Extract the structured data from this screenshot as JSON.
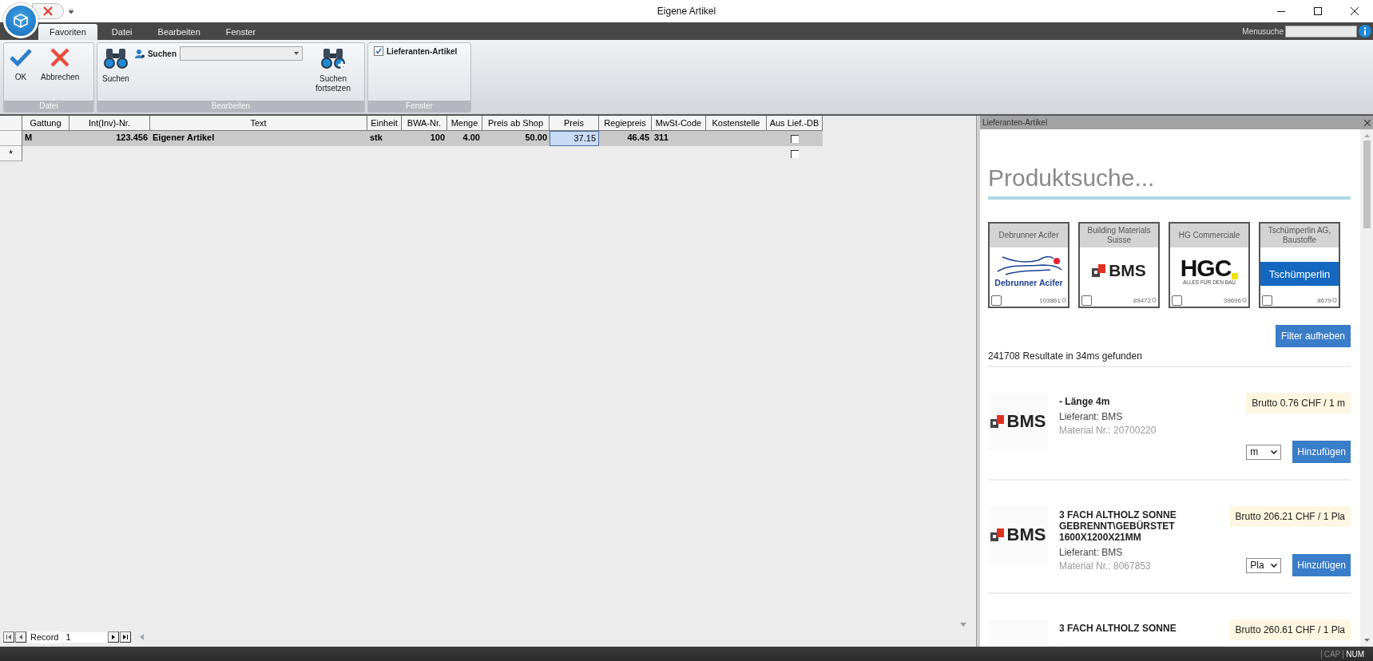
{
  "window": {
    "title": "Eigene Artikel"
  },
  "ribbon": {
    "tabs": [
      {
        "label": "Favoriten",
        "selected": true
      },
      {
        "label": "Datei",
        "selected": false
      },
      {
        "label": "Bearbeiten",
        "selected": false
      },
      {
        "label": "Fenster",
        "selected": false
      }
    ],
    "menu_search": {
      "label": "Menusuche"
    },
    "groups": [
      {
        "title": "Datei",
        "items": [
          {
            "kind": "confirm",
            "label": "OK"
          },
          {
            "kind": "cancel",
            "label": "Abbrechen"
          }
        ]
      },
      {
        "title": "Bearbeiten",
        "items": [
          {
            "kind": "search",
            "label": "Suchen"
          },
          {
            "kind": "combo",
            "label": "Suchen"
          },
          {
            "kind": "search_next",
            "label": "Suchen fortsetzen"
          }
        ]
      },
      {
        "title": "Fenster",
        "items": [
          {
            "kind": "checkbox",
            "label": "Lieferanten-Artikel",
            "checked": true
          }
        ]
      }
    ]
  },
  "grid": {
    "columns": [
      "Gattung",
      "Int(Inv)-Nr.",
      "Text",
      "Einheit",
      "BWA-Nr.",
      "Menge",
      "Preis ab Shop",
      "Preis",
      "Regiepreis",
      "MwSt-Code",
      "Kostenstelle",
      "Aus Lief.-DB"
    ],
    "rows": [
      {
        "current": true,
        "aus_lief_db": false,
        "cells": [
          {
            "text": "M",
            "selected": false
          },
          {
            "text": "123.456",
            "selected": false
          },
          {
            "text": "Eigener Artikel",
            "selected": false
          },
          {
            "text": "stk",
            "selected": false
          },
          {
            "text": "100",
            "selected": false
          },
          {
            "text": "4.00",
            "selected": false
          },
          {
            "text": "50.00",
            "selected": false
          },
          {
            "text": "37.15",
            "selected": true
          },
          {
            "text": "46.45",
            "selected": false
          },
          {
            "text": "311",
            "selected": false
          },
          {
            "text": "",
            "selected": false
          }
        ]
      }
    ],
    "new_row": {
      "marker": "*",
      "aus_lief_db": false
    },
    "navigator": {
      "label": "Record",
      "value": "1"
    }
  },
  "side_panel": {
    "title": "Lieferanten-Artikel",
    "heading": "Produktsuche...",
    "vendors": [
      {
        "name": "Debrunner Acifer",
        "logo": {
          "kind": "debrunner",
          "text": "Debrunner Acifer"
        },
        "checked": false,
        "count": "103861"
      },
      {
        "name": "Building Materials Suisse",
        "logo": {
          "kind": "bms",
          "text": "BMS"
        },
        "checked": false,
        "count": "89472"
      },
      {
        "name": "HG Commerciale",
        "logo": {
          "kind": "hgc",
          "text": "HGC",
          "tagline": "ALLES FÜR DEN BAU"
        },
        "checked": false,
        "count": "39696"
      },
      {
        "name": "Tschümperlin AG, Baustoffe",
        "logo": {
          "kind": "tschuemperlin",
          "text": "Tschümperlin"
        },
        "checked": false,
        "count": "8679"
      }
    ],
    "filter_button": "Filter aufheben",
    "result_count": "241708 Resultate in 34ms gefunden",
    "results": [
      {
        "logo": {
          "kind": "bms",
          "text": "BMS"
        },
        "title": "- Länge 4m",
        "supplier": "Lieferant: BMS",
        "material": "Material Nr.: 20700220",
        "price": "Brutto 0.76 CHF / 1 m",
        "unit": "m",
        "button": "Hinzufügen"
      },
      {
        "logo": {
          "kind": "bms",
          "text": "BMS"
        },
        "title": "3 FACH ALTHOLZ SONNE GEBRENNT\\GEBÜRSTET 1600X1200X21MM",
        "supplier": "Lieferant: BMS",
        "material": "Material Nr.: 8067853",
        "price": "Brutto 206.21 CHF / 1 Pla",
        "unit": "Pla",
        "button": "Hinzufügen"
      },
      {
        "title": "3 FACH ALTHOLZ SONNE",
        "price": "Brutto 260.61 CHF / 1 Pla"
      }
    ]
  },
  "status_bar": {
    "indicators": [
      {
        "label": "CAP",
        "on": false
      },
      {
        "label": "NUM",
        "on": true
      }
    ]
  }
}
